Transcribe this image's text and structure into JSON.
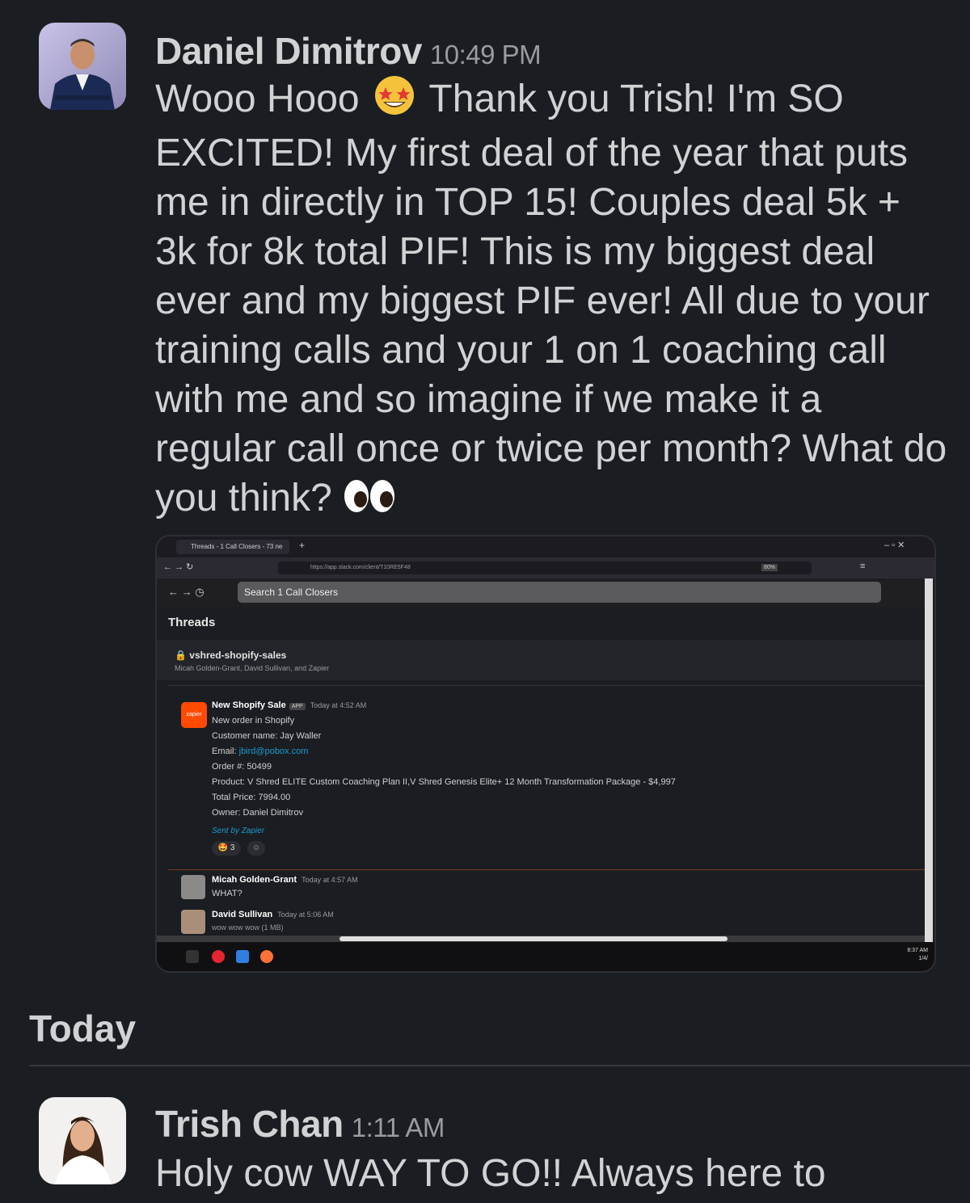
{
  "messages": [
    {
      "author": "Daniel Dimitrov",
      "time": "10:49 PM",
      "text_before_emoji": "Wooo Hooo",
      "text_after_emoji": "Thank you Trish! I'm SO EXCITED! My first deal of the year that puts me in directly in TOP 15! Couples deal 5k + 3k for 8k total PIF! This is my biggest deal ever and my biggest PIF ever! All due to your training calls and your 1 on 1 coaching call with me and so imagine if we make it a regular call once or twice per month? What do you think?",
      "emoji_1": "star-struck-emoji",
      "emoji_2": "eyes-emoji"
    },
    {
      "author": "Trish Chan",
      "time": "1:11 AM",
      "text": "Holy cow WAY TO GO!! Always here to"
    }
  ],
  "day_divider": "Today",
  "attachment": {
    "browser_tab": "Threads - 1 Call Closers - 73 ne",
    "url": "https://app.slack.com/client/T10RE5F48",
    "zoom": "80%",
    "search_placeholder": "Search 1 Call Closers",
    "view_title": "Threads",
    "channel": "vshred-shopify-sales",
    "channel_members": "Micah Golden-Grant, David Sullivan, and Zapier",
    "post": {
      "app_logo": "zapier",
      "author": "New Shopify Sale",
      "badge": "APP",
      "time": "Today at 4:52 AM",
      "lines": [
        "New order in Shopify",
        "Customer name: Jay Waller",
        "Order #: 50499",
        "Product: V Shred ELITE Custom Coaching Plan II,V Shred Genesis Elite+ 12 Month Transformation Package - $4,997",
        "Total Price: 7994.00",
        "Owner: Daniel Dimitrov"
      ],
      "email_label": "Email:",
      "email": "jbird@pobox.com",
      "footer": "Sent by Zapier",
      "reaction_count": "3"
    },
    "replies": [
      {
        "author": "Micah Golden-Grant",
        "time": "Today at 4:57 AM",
        "text": "WHAT?"
      },
      {
        "author": "David Sullivan",
        "time": "Today at 5:06 AM",
        "text": "wow wow wow (1 MB)"
      }
    ],
    "clock": "8:37 AM",
    "clock_date": "1/4/"
  },
  "colors": {
    "background": "#1a1d21",
    "text": "#d1d2d3",
    "muted": "#9a9b9d",
    "link": "#1d9bd1",
    "zapier": "#ff4a00"
  }
}
